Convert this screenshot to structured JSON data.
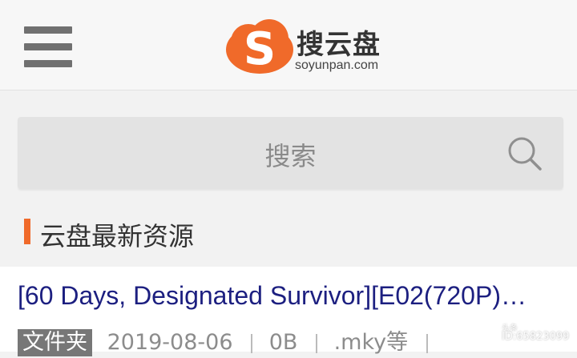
{
  "header": {
    "logo_cn": "搜云盘",
    "logo_en": "soyunpan.com",
    "logo_letter": "S"
  },
  "search": {
    "placeholder": "搜索"
  },
  "section": {
    "title": "云盘最新资源"
  },
  "list": [
    {
      "title": "[60 Days, Designated Survivor][E02(720P)…",
      "type": "文件夹",
      "date": "2019-08-06",
      "size": "0B",
      "ext": ".mky等"
    }
  ],
  "watermark": {
    "top": "头条",
    "id": "ID:65823099"
  },
  "colors": {
    "brand": "#f06a2a",
    "link": "#1c1f80"
  }
}
